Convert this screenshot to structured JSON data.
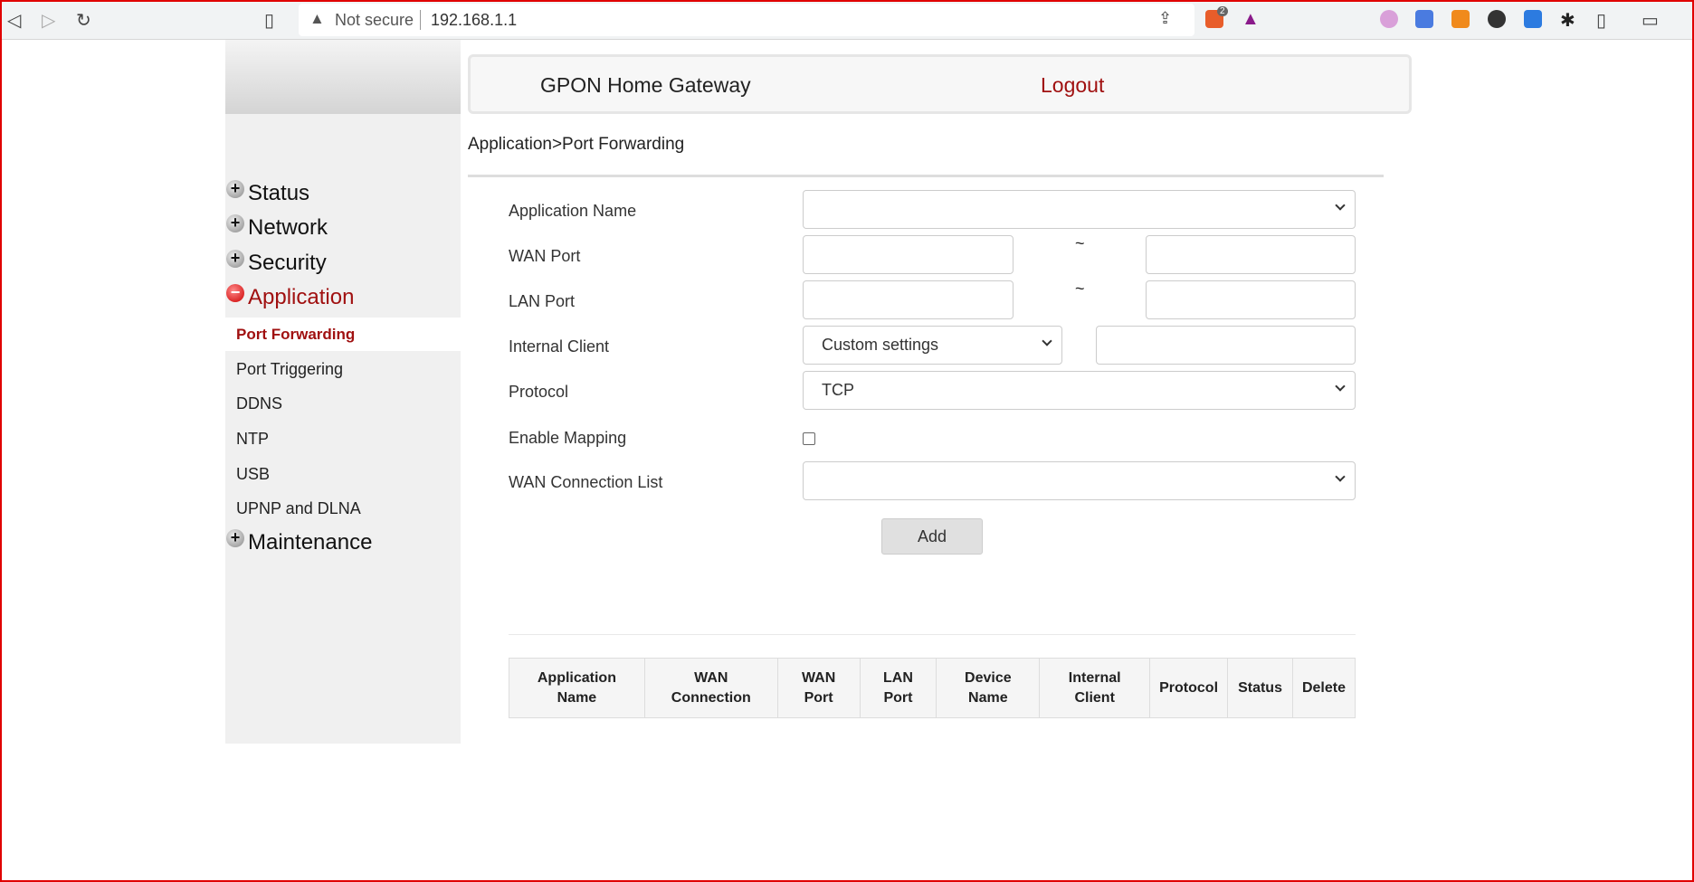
{
  "browser": {
    "not_secure": "Not secure",
    "url": "192.168.1.1",
    "brave_badge": "2"
  },
  "header": {
    "title": "GPON Home Gateway",
    "logout": "Logout"
  },
  "breadcrumb": "Application>Port Forwarding",
  "sidebar": {
    "menus": [
      {
        "label": "Status",
        "state": "collapsed"
      },
      {
        "label": "Network",
        "state": "collapsed"
      },
      {
        "label": "Security",
        "state": "collapsed"
      },
      {
        "label": "Application",
        "state": "expanded"
      }
    ],
    "sub_items": [
      {
        "label": "Port Forwarding",
        "active": true
      },
      {
        "label": "Port Triggering"
      },
      {
        "label": "DDNS"
      },
      {
        "label": "NTP"
      },
      {
        "label": "USB"
      },
      {
        "label": "UPNP and DLNA"
      }
    ],
    "maintenance": "Maintenance"
  },
  "form": {
    "application_name": {
      "label": "Application Name",
      "value": ""
    },
    "wan_port": {
      "label": "WAN Port",
      "start": "",
      "end": "",
      "sep": "~"
    },
    "lan_port": {
      "label": "LAN Port",
      "start": "",
      "end": "",
      "sep": "~"
    },
    "internal_client": {
      "label": "Internal Client",
      "mode": "Custom settings",
      "value": ""
    },
    "protocol": {
      "label": "Protocol",
      "value": "TCP"
    },
    "enable_mapping": {
      "label": "Enable Mapping",
      "checked": false
    },
    "wan_connection_list": {
      "label": "WAN Connection List",
      "value": ""
    },
    "add_label": "Add"
  },
  "table": {
    "headers": [
      "Application Name",
      "WAN Connection",
      "WAN Port",
      "LAN Port",
      "Device Name",
      "Internal Client",
      "Protocol",
      "Status",
      "Delete"
    ],
    "rows": []
  },
  "colors": {
    "accent": "#a01010"
  }
}
